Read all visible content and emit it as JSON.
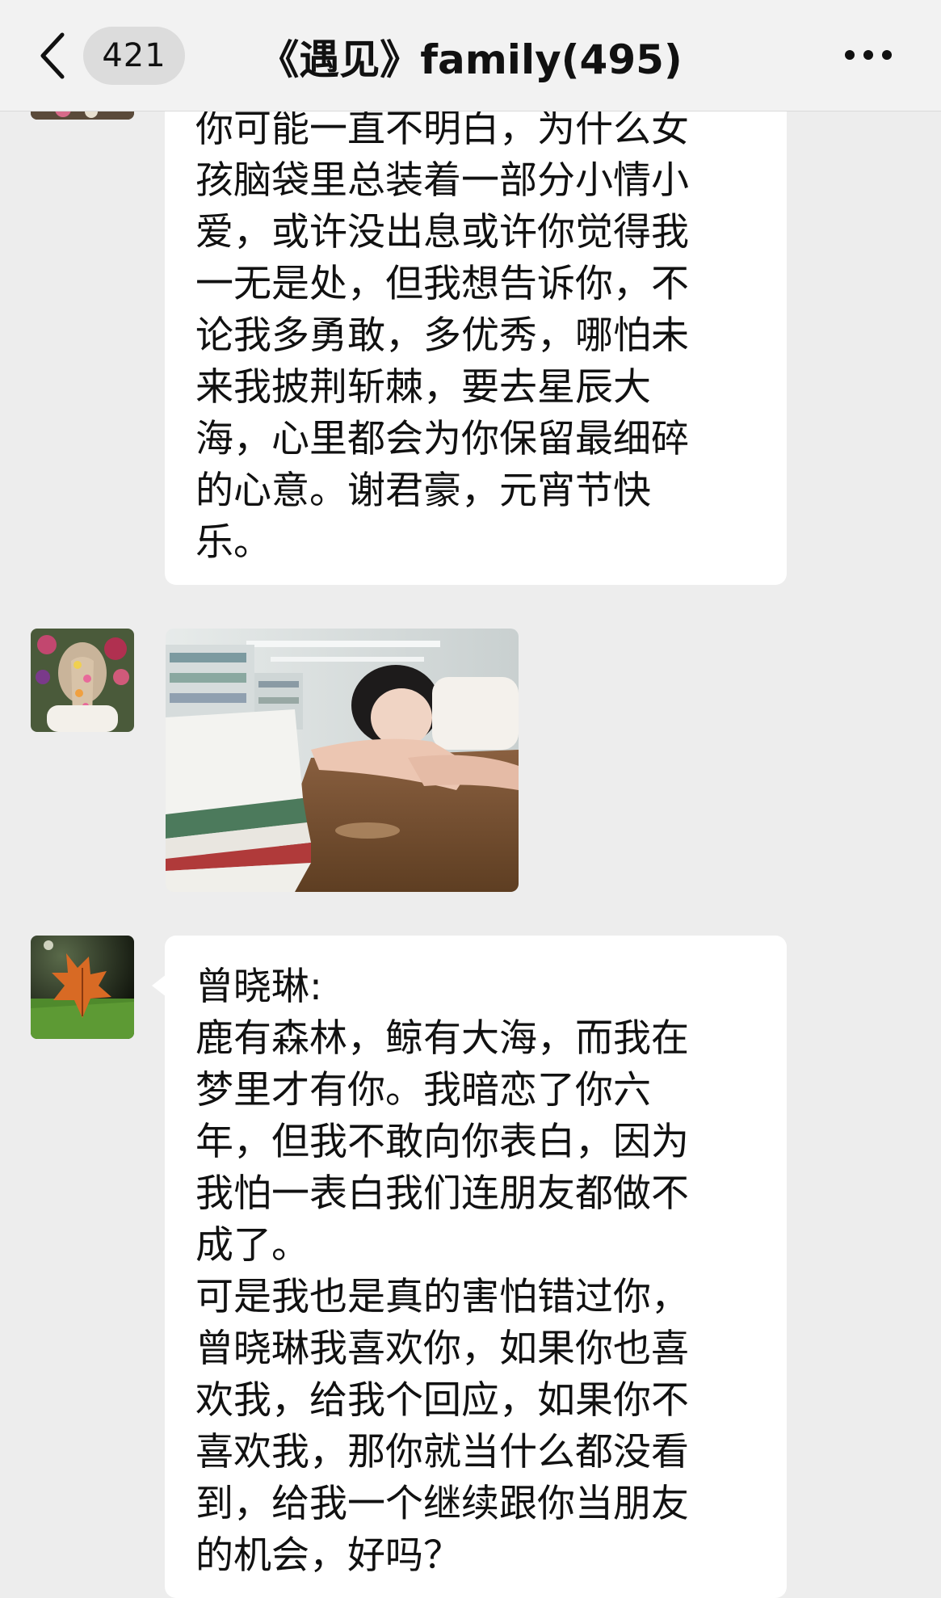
{
  "header": {
    "back_icon": "chevron-left-icon",
    "unread_count": "421",
    "title": "《遇见》family(495)",
    "more_icon": "ellipsis-icon"
  },
  "messages": [
    {
      "type": "text",
      "avatar": "flower-braid-avatar",
      "lines": [
        "你可能一直不明白，为什么女",
        "孩脑袋里总装着一部分小情小",
        "爱，或许没出息或许你觉得我",
        "一无是处，但我想告诉你，不",
        "论我多勇敢，多优秀，哪怕未",
        "来我披荆斩棘，要去星辰大",
        "海，心里都会为你保留最细碎",
        "的心意。谢君豪，元宵节快",
        "乐。"
      ]
    },
    {
      "type": "image",
      "avatar": "flower-braid-avatar",
      "image_desc": "girl-sleeping-on-library-desk-photo"
    },
    {
      "type": "text",
      "avatar": "autumn-leaf-avatar",
      "sender": "曾晓琳:",
      "lines": [
        "鹿有森林，鲸有大海，而我在",
        "梦里才有你。我暗恋了你六",
        "年，但我不敢向你表白，因为",
        "我怕一表白我们连朋友都做不",
        "成了。",
        "可是我也是真的害怕错过你，",
        "曾晓琳我喜欢你，如果你也喜",
        "欢我，给我个回应，如果你不",
        "喜欢我，那你就当什么都没看",
        "到，给我一个继续跟你当朋友",
        "的机会，好吗？"
      ]
    }
  ],
  "colors": {
    "background": "#EDEDED",
    "navbar": "#F2F2F2",
    "bubble": "#FFFFFF",
    "badge": "#DCDCDC"
  }
}
